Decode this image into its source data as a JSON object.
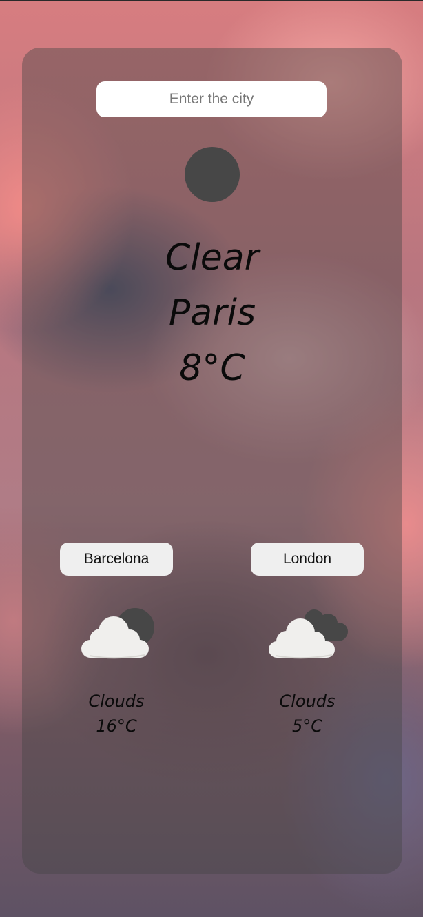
{
  "search": {
    "placeholder": "Enter the city",
    "value": ""
  },
  "current": {
    "condition": "Clear",
    "city": "Paris",
    "temperature": "8°C",
    "icon": "clear-night-icon"
  },
  "cities": [
    {
      "name": "Barcelona",
      "condition": "Clouds",
      "temperature": "16°C",
      "icon": "cloud-moon-icon"
    },
    {
      "name": "London",
      "condition": "Clouds",
      "temperature": "5°C",
      "icon": "clouds-icon"
    }
  ],
  "colors": {
    "card": "#464646",
    "input_bg": "#ffffff",
    "button_bg": "#efefef",
    "text": "#0a0a0a"
  }
}
